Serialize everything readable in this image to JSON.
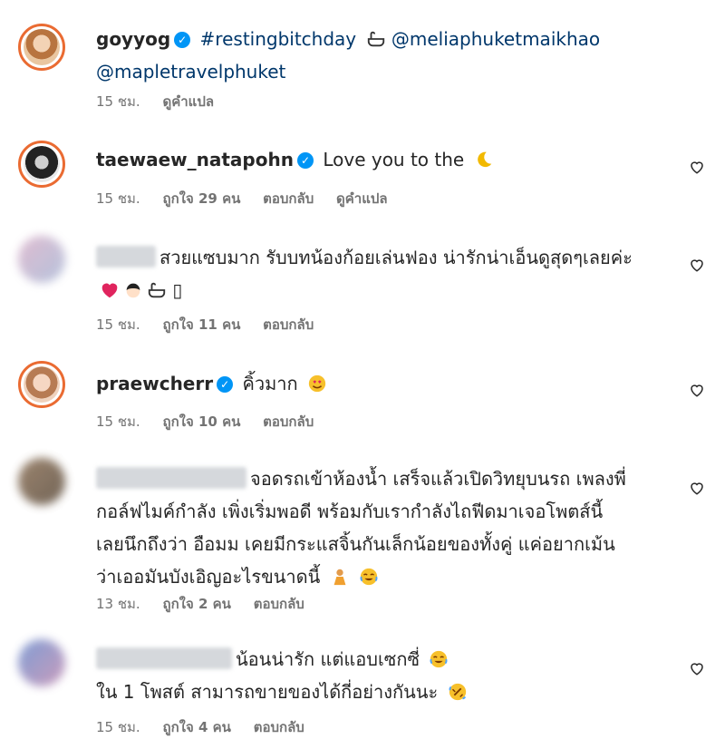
{
  "comments": [
    {
      "username": "goyyog",
      "verified": true,
      "hashtag": "#restingbitchday",
      "mention1": "@meliaphuketmaikhao",
      "mention2": "@mapletravelphuket",
      "time": "15 ชม.",
      "see_translation": "ดูคำแปล"
    },
    {
      "username": "taewaew_natapohn",
      "verified": true,
      "text": "Love you to the",
      "time": "15 ชม.",
      "likes": "ถูกใจ 29 คน",
      "reply": "ตอบกลับ",
      "see_translation": "ดูคำแปล"
    },
    {
      "text_line1": "สวยแซบมาก รับบทน้องก้อยเล่นฟอง น่ารักน่าเอ็นดูสุดๆเลยค่ะ",
      "text_line2": "▯",
      "time": "15 ชม.",
      "likes": "ถูกใจ 11 คน",
      "reply": "ตอบกลับ"
    },
    {
      "username": "praewcherr",
      "verified": true,
      "text": "คิ้วมาก",
      "time": "15 ชม.",
      "likes": "ถูกใจ 10 คน",
      "reply": "ตอบกลับ"
    },
    {
      "text_line1": "จอดรถเข้าห้องน้ำ เสร็จแล้วเปิดวิทยุบนรถ เพลงพี่",
      "text_line2": "กอล์ฟไมค์กำลัง เพิ่งเริ่มพอดี พร้อมกับเรากำลังไถฟีดมาเจอโพตส์นี้",
      "text_line3": "เลยนึกถึงว่า อือมม เคยมีกระแสจิ้นกันเล็กน้อยของทั้งคู่ แค่อยากเม้น",
      "text_line4": "ว่าเออมันบังเอิญอะไรขนาดนี้",
      "time": "13 ชม.",
      "likes": "ถูกใจ 2 คน",
      "reply": "ตอบกลับ"
    },
    {
      "text_line1": "น้อนน่ารัก แต่แอบเซกซี่",
      "text_line2": "ใน 1 โพสต์ สามารถขายของได้กี่อย่างกันนะ",
      "time": "15 ชม.",
      "likes": "ถูกใจ 4 คน",
      "reply": "ตอบกลับ"
    }
  ],
  "icons": {
    "like": "heart-outline-icon",
    "verified": "verified-badge-icon"
  },
  "colors": {
    "link": "#00376b",
    "meta": "#737373",
    "verified": "#0095f6",
    "story_ring": "#ea6b32"
  }
}
